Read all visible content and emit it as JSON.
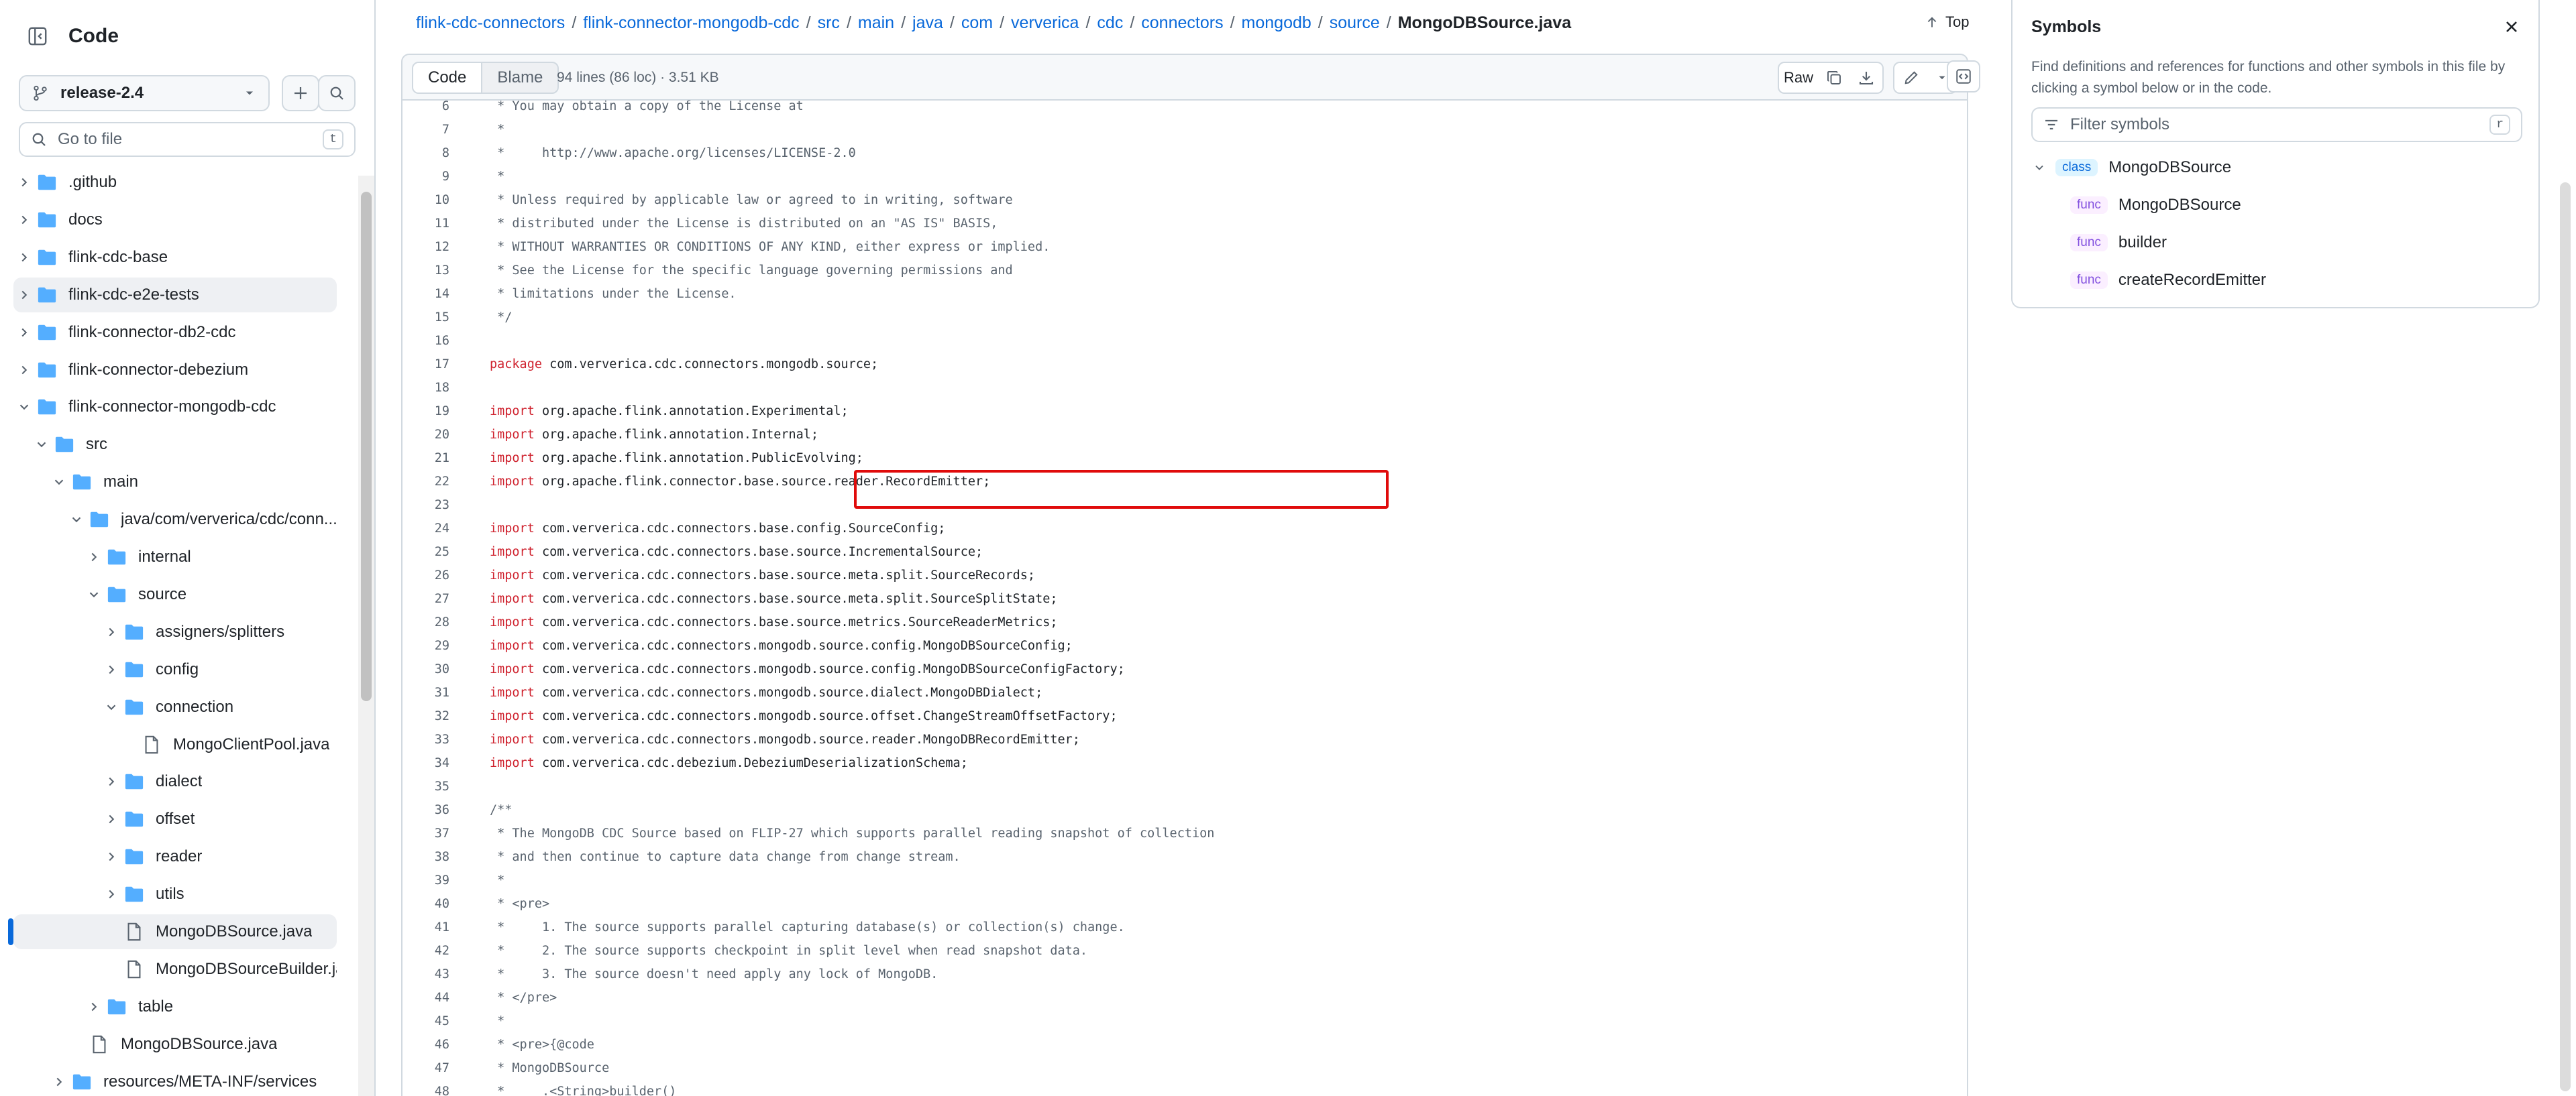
{
  "sidebar": {
    "title": "Code",
    "branch": "release-2.4",
    "search_placeholder": "Go to file",
    "search_shortcut": "t",
    "tree": [
      {
        "name": ".github",
        "type": "dir",
        "expanded": false
      },
      {
        "name": "docs",
        "type": "dir",
        "expanded": false
      },
      {
        "name": "flink-cdc-base",
        "type": "dir",
        "expanded": false
      },
      {
        "name": "flink-cdc-e2e-tests",
        "type": "dir",
        "expanded": false,
        "hover": true
      },
      {
        "name": "flink-connector-db2-cdc",
        "type": "dir",
        "expanded": false
      },
      {
        "name": "flink-connector-debezium",
        "type": "dir",
        "expanded": false
      },
      {
        "name": "flink-connector-mongodb-cdc",
        "type": "dir",
        "expanded": true
      },
      {
        "name": "src",
        "type": "dir",
        "expanded": true
      },
      {
        "name": "main",
        "type": "dir",
        "expanded": true
      },
      {
        "name": "java/com/ververica/cdc/conn...",
        "type": "dir",
        "expanded": true
      },
      {
        "name": "internal",
        "type": "dir",
        "expanded": false
      },
      {
        "name": "source",
        "type": "dir",
        "expanded": true
      },
      {
        "name": "assigners/splitters",
        "type": "dir",
        "expanded": false
      },
      {
        "name": "config",
        "type": "dir",
        "expanded": false
      },
      {
        "name": "connection",
        "type": "dir",
        "expanded": true
      },
      {
        "name": "MongoClientPool.java",
        "type": "file"
      },
      {
        "name": "dialect",
        "type": "dir",
        "expanded": false
      },
      {
        "name": "offset",
        "type": "dir",
        "expanded": false
      },
      {
        "name": "reader",
        "type": "dir",
        "expanded": false
      },
      {
        "name": "utils",
        "type": "dir",
        "expanded": false
      },
      {
        "name": "MongoDBSource.java",
        "type": "file",
        "selected": true
      },
      {
        "name": "MongoDBSourceBuilder.ja...",
        "type": "file"
      },
      {
        "name": "table",
        "type": "dir",
        "expanded": false
      },
      {
        "name": "MongoDBSource.java",
        "type": "file"
      },
      {
        "name": "resources/META-INF/services",
        "type": "dir",
        "expanded": false
      }
    ]
  },
  "breadcrumb": {
    "parts": [
      "flink-cdc-connectors",
      "flink-connector-mongodb-cdc",
      "src",
      "main",
      "java",
      "com",
      "ververica",
      "cdc",
      "connectors",
      "mongodb",
      "source"
    ],
    "separator": "/",
    "current": "MongoDBSource.java"
  },
  "top_link": "Top",
  "file_header": {
    "tab_code": "Code",
    "tab_blame": "Blame",
    "meta": "94 lines (86 loc) · 3.51 KB",
    "raw_label": "Raw"
  },
  "code_lines": [
    {
      "n": "6",
      "text": " * You may obtain a copy of the License at",
      "kind": "comment"
    },
    {
      "n": "7",
      "text": " *",
      "kind": "comment"
    },
    {
      "n": "8",
      "text": " *     http://www.apache.org/licenses/LICENSE-2.0",
      "kind": "comment"
    },
    {
      "n": "9",
      "text": " *",
      "kind": "comment"
    },
    {
      "n": "10",
      "text": " * Unless required by applicable law or agreed to in writing, software",
      "kind": "comment"
    },
    {
      "n": "11",
      "text": " * distributed under the License is distributed on an \"AS IS\" BASIS,",
      "kind": "comment"
    },
    {
      "n": "12",
      "text": " * WITHOUT WARRANTIES OR CONDITIONS OF ANY KIND, either express or implied.",
      "kind": "comment"
    },
    {
      "n": "13",
      "text": " * See the License for the specific language governing permissions and",
      "kind": "comment"
    },
    {
      "n": "14",
      "text": " * limitations under the License.",
      "kind": "comment"
    },
    {
      "n": "15",
      "text": " */",
      "kind": "comment"
    },
    {
      "n": "16",
      "text": "",
      "kind": "plain"
    },
    {
      "n": "17",
      "text": "package com.ververica.cdc.connectors.mongodb.source;",
      "kind": "code"
    },
    {
      "n": "18",
      "text": "",
      "kind": "plain"
    },
    {
      "n": "19",
      "text": "import org.apache.flink.annotation.Experimental;",
      "kind": "code"
    },
    {
      "n": "20",
      "text": "import org.apache.flink.annotation.Internal;",
      "kind": "code"
    },
    {
      "n": "21",
      "text": "import org.apache.flink.annotation.PublicEvolving;",
      "kind": "code"
    },
    {
      "n": "22",
      "text": "import org.apache.flink.connector.base.source.reader.RecordEmitter;",
      "kind": "code"
    },
    {
      "n": "23",
      "text": "",
      "kind": "plain"
    },
    {
      "n": "24",
      "text": "import com.ververica.cdc.connectors.base.config.SourceConfig;",
      "kind": "code"
    },
    {
      "n": "25",
      "text": "import com.ververica.cdc.connectors.base.source.IncrementalSource;",
      "kind": "code"
    },
    {
      "n": "26",
      "text": "import com.ververica.cdc.connectors.base.source.meta.split.SourceRecords;",
      "kind": "code"
    },
    {
      "n": "27",
      "text": "import com.ververica.cdc.connectors.base.source.meta.split.SourceSplitState;",
      "kind": "code"
    },
    {
      "n": "28",
      "text": "import com.ververica.cdc.connectors.base.source.metrics.SourceReaderMetrics;",
      "kind": "code"
    },
    {
      "n": "29",
      "text": "import com.ververica.cdc.connectors.mongodb.source.config.MongoDBSourceConfig;",
      "kind": "code"
    },
    {
      "n": "30",
      "text": "import com.ververica.cdc.connectors.mongodb.source.config.MongoDBSourceConfigFactory;",
      "kind": "code"
    },
    {
      "n": "31",
      "text": "import com.ververica.cdc.connectors.mongodb.source.dialect.MongoDBDialect;",
      "kind": "code"
    },
    {
      "n": "32",
      "text": "import com.ververica.cdc.connectors.mongodb.source.offset.ChangeStreamOffsetFactory;",
      "kind": "code"
    },
    {
      "n": "33",
      "text": "import com.ververica.cdc.connectors.mongodb.source.reader.MongoDBRecordEmitter;",
      "kind": "code"
    },
    {
      "n": "34",
      "text": "import com.ververica.cdc.debezium.DebeziumDeserializationSchema;",
      "kind": "code"
    },
    {
      "n": "35",
      "text": "",
      "kind": "plain"
    },
    {
      "n": "36",
      "text": "/**",
      "kind": "comment"
    },
    {
      "n": "37",
      "text": " * The MongoDB CDC Source based on FLIP-27 which supports parallel reading snapshot of collection",
      "kind": "comment"
    },
    {
      "n": "38",
      "text": " * and then continue to capture data change from change stream.",
      "kind": "comment"
    },
    {
      "n": "39",
      "text": " *",
      "kind": "comment"
    },
    {
      "n": "40",
      "text": " * <pre>",
      "kind": "comment"
    },
    {
      "n": "41",
      "text": " *     1. The source supports parallel capturing database(s) or collection(s) change.",
      "kind": "comment"
    },
    {
      "n": "42",
      "text": " *     2. The source supports checkpoint in split level when read snapshot data.",
      "kind": "comment"
    },
    {
      "n": "43",
      "text": " *     3. The source doesn't need apply any lock of MongoDB.",
      "kind": "comment"
    },
    {
      "n": "44",
      "text": " * </pre>",
      "kind": "comment"
    },
    {
      "n": "45",
      "text": " *",
      "kind": "comment"
    },
    {
      "n": "46",
      "text": " * <pre>{@code",
      "kind": "comment"
    },
    {
      "n": "47",
      "text": " * MongoDBSource",
      "kind": "comment"
    },
    {
      "n": "48",
      "text": " *     .<String>builder()",
      "kind": "comment"
    }
  ],
  "symbols": {
    "title": "Symbols",
    "description": "Find definitions and references for functions and other symbols in this file by clicking a symbol below or in the code.",
    "filter_placeholder": "Filter symbols",
    "filter_shortcut": "r",
    "items": [
      {
        "kind": "class",
        "name": "MongoDBSource"
      },
      {
        "kind": "func",
        "name": "MongoDBSource"
      },
      {
        "kind": "func",
        "name": "builder"
      },
      {
        "kind": "func",
        "name": "createRecordEmitter"
      }
    ]
  },
  "colors": {
    "link": "#0969da",
    "keyword": "#cf222e",
    "comment": "#59636e",
    "highlight_box": "#e00b0b",
    "folder": "#54aeff"
  }
}
